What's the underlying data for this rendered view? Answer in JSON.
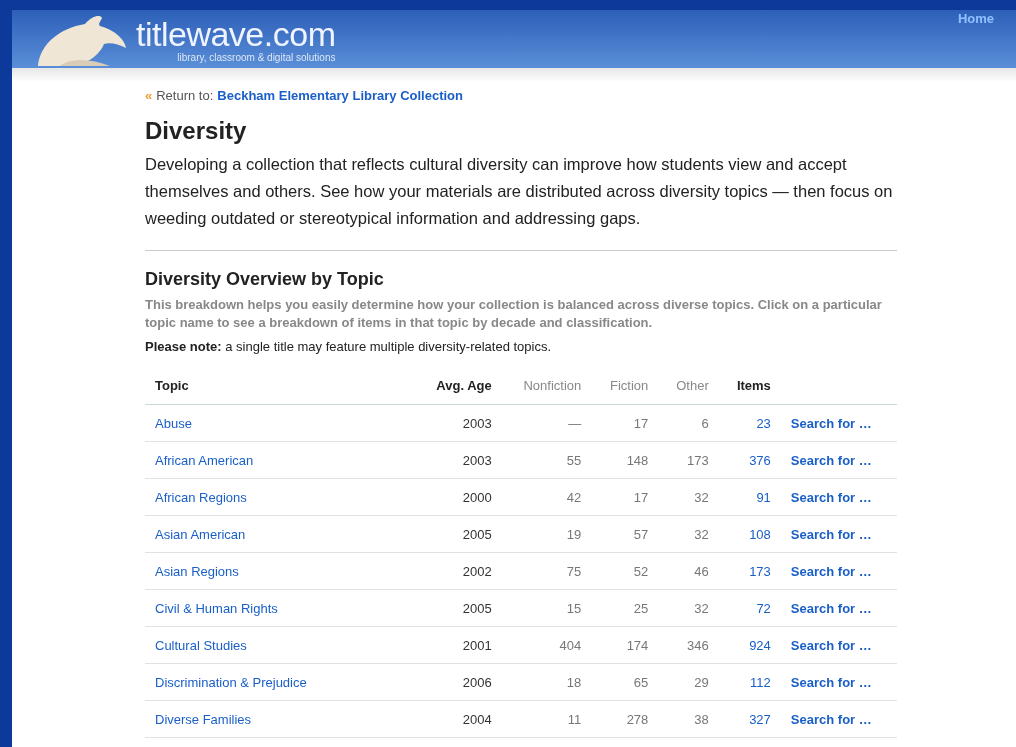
{
  "header": {
    "logo": "titlewave.com",
    "tagline": "library, classroom & digital solutions",
    "nav": [
      "Home"
    ]
  },
  "breadcrumb": {
    "icon": "«",
    "label": "Return to:",
    "link": "Beckham Elementary Library Collection"
  },
  "title": "Diversity",
  "intro": "Developing a collection that reflects cultural diversity can improve how students view and accept themselves and others. See how your materials are distributed across diversity topics — then focus on weeding outdated or stereotypical information and addressing gaps.",
  "section": {
    "title": "Diversity Overview by Topic",
    "description": "This breakdown helps you easily determine how your collection is balanced across diverse topics. Click on a particular topic name to see a breakdown of items in that topic by decade and classification.",
    "note": "**Please note:** a single title may feature multiple diversity-related topics."
  },
  "table": {
    "columns": [
      "Topic",
      "Avg. Age",
      "Nonfiction",
      "Fiction",
      "Other",
      "Items"
    ],
    "rows": [
      {
        "topic": "Abuse",
        "avg_age": "2003",
        "nonfiction": "—",
        "fiction": "17",
        "other": "6",
        "items": "23",
        "action": "Search for …"
      },
      {
        "topic": "African American",
        "avg_age": "2003",
        "nonfiction": "55",
        "fiction": "148",
        "other": "173",
        "items": "376",
        "action": "Search for …"
      },
      {
        "topic": "African Regions",
        "avg_age": "2000",
        "nonfiction": "42",
        "fiction": "17",
        "other": "32",
        "items": "91",
        "action": "Search for …"
      },
      {
        "topic": "Asian American",
        "avg_age": "2005",
        "nonfiction": "19",
        "fiction": "57",
        "other": "32",
        "items": "108",
        "action": "Search for …"
      },
      {
        "topic": "Asian Regions",
        "avg_age": "2002",
        "nonfiction": "75",
        "fiction": "52",
        "other": "46",
        "items": "173",
        "action": "Search for …"
      },
      {
        "topic": "Civil & Human Rights",
        "avg_age": "2005",
        "nonfiction": "15",
        "fiction": "25",
        "other": "32",
        "items": "72",
        "action": "Search for …"
      },
      {
        "topic": "Cultural Studies",
        "avg_age": "2001",
        "nonfiction": "404",
        "fiction": "174",
        "other": "346",
        "items": "924",
        "action": "Search for …"
      },
      {
        "topic": "Discrimination & Prejudice",
        "avg_age": "2006",
        "nonfiction": "18",
        "fiction": "65",
        "other": "29",
        "items": "112",
        "action": "Search for …"
      },
      {
        "topic": "Diverse Families",
        "avg_age": "2004",
        "nonfiction": "11",
        "fiction": "278",
        "other": "38",
        "items": "327",
        "action": "Search for …"
      }
    ]
  }
}
